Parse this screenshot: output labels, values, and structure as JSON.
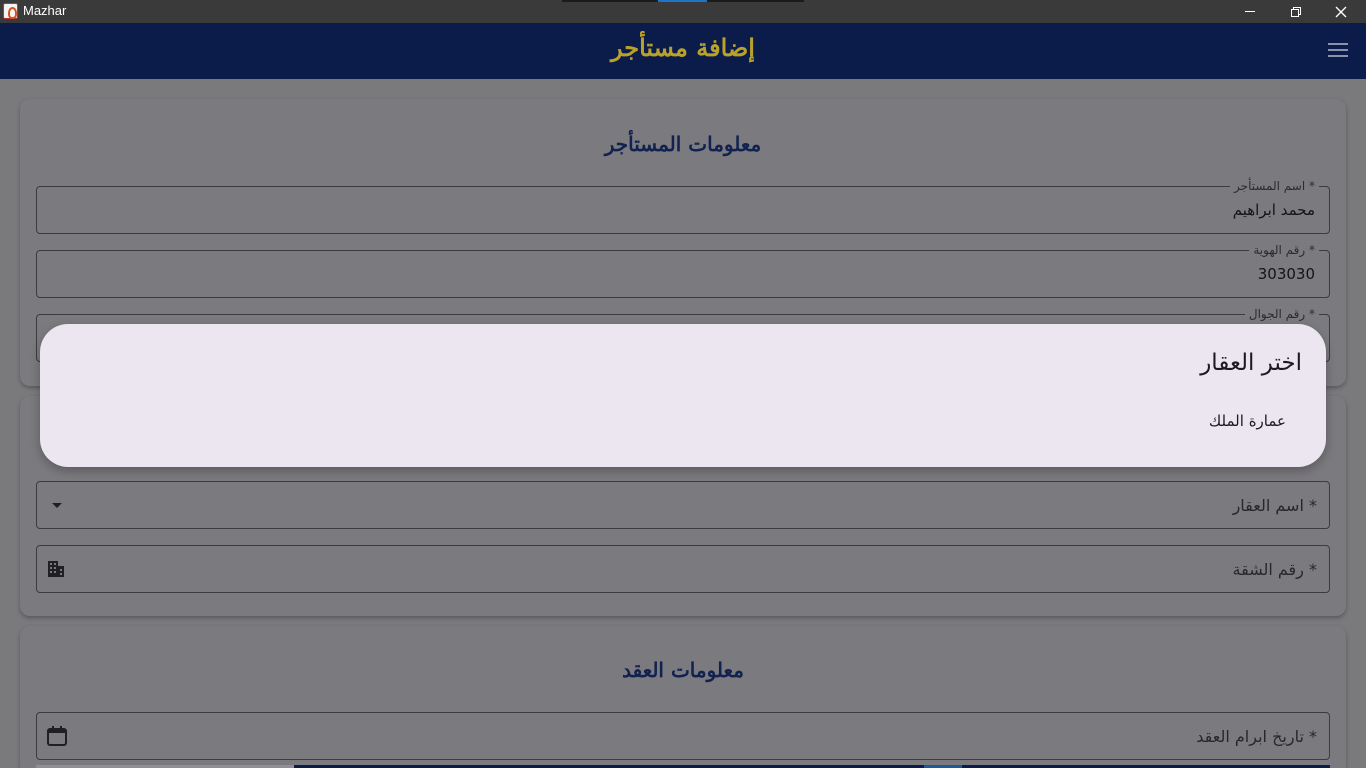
{
  "window": {
    "app_title": "Mazhar"
  },
  "appbar": {
    "title": "إضافة مستأجر"
  },
  "tenant_section": {
    "title": "معلومات المستأجر",
    "name_field": {
      "label": "اسم المستأجر *",
      "value": "محمد ابراهيم"
    },
    "id_field": {
      "label": "رقم الهوية *",
      "value": "303030"
    },
    "phone_field": {
      "label": "رقم الجوال *"
    }
  },
  "property_section": {
    "property_field": {
      "placeholder": "اسم العقار *"
    },
    "apartment_field": {
      "placeholder": "رقم الشقة *"
    }
  },
  "contract_section": {
    "title": "معلومات العقد",
    "contract_date_field": {
      "placeholder": "تاريخ ابرام العقد *"
    }
  },
  "dialog": {
    "title": "اختر العقار",
    "options": [
      "عمارة الملك"
    ]
  },
  "icons": {
    "menu": "menu-icon",
    "dropdown": "dropdown-arrow-icon",
    "apartment": "building-icon",
    "date": "calendar-icon"
  },
  "colors": {
    "appbar_bg": "#0b1b4a",
    "appbar_title": "#b8a22a",
    "section_title": "#112250",
    "dialog_bg": "#ebe6f0"
  }
}
